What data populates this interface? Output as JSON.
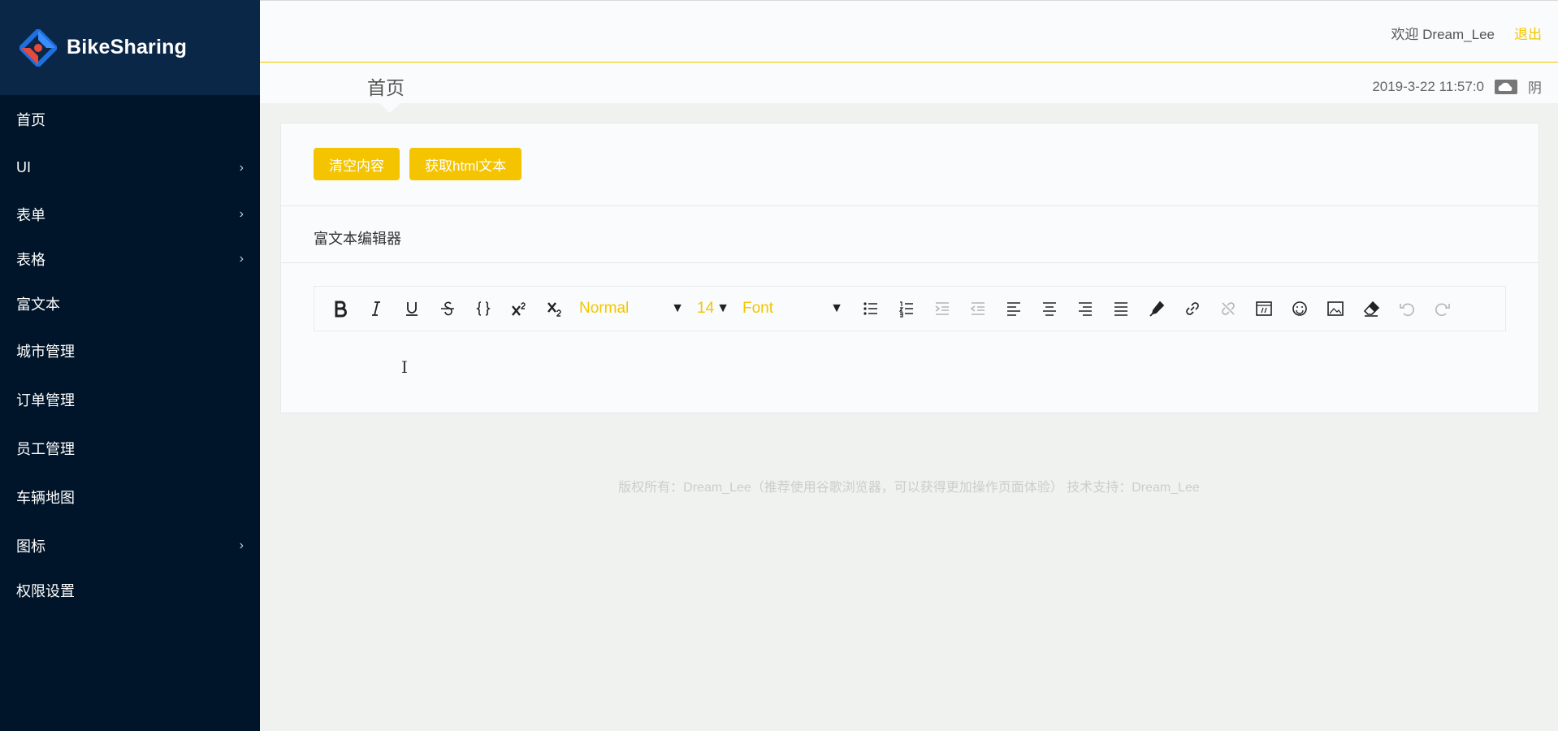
{
  "app": {
    "title": "BikeSharing"
  },
  "sidebar": {
    "items": [
      {
        "label": "首页",
        "has_children": false
      },
      {
        "label": "UI",
        "has_children": true
      },
      {
        "label": "表单",
        "has_children": true
      },
      {
        "label": "表格",
        "has_children": true
      },
      {
        "label": "富文本",
        "has_children": false
      },
      {
        "label": "城市管理",
        "has_children": false
      },
      {
        "label": "订单管理",
        "has_children": false
      },
      {
        "label": "员工管理",
        "has_children": false
      },
      {
        "label": "车辆地图",
        "has_children": false
      },
      {
        "label": "图标",
        "has_children": true
      },
      {
        "label": "权限设置",
        "has_children": false
      }
    ]
  },
  "header": {
    "welcome": "欢迎 Dream_Lee",
    "logout": "退出",
    "breadcrumb": "首页",
    "datetime": "2019-3-22 11:57:0",
    "weather": "阴",
    "weather_icon": "cloud-icon"
  },
  "actions": {
    "clear_label": "清空内容",
    "get_html_label": "获取html文本"
  },
  "editor": {
    "title": "富文本编辑器",
    "header_select": "Normal",
    "size_select": "14",
    "font_select": "Font",
    "toolbar_icons": [
      "bold-icon",
      "italic-icon",
      "underline-icon",
      "strikethrough-icon",
      "code-icon",
      "superscript-icon",
      "subscript-icon",
      "bullet-list-icon",
      "ordered-list-icon",
      "indent-icon",
      "outdent-icon",
      "align-left-icon",
      "align-center-icon",
      "align-right-icon",
      "align-justify-icon",
      "color-picker-icon",
      "link-icon",
      "unlink-icon",
      "embed-icon",
      "emoji-icon",
      "image-icon",
      "eraser-icon",
      "undo-icon",
      "redo-icon"
    ],
    "cursor_glyph": "I"
  },
  "footer": {
    "text": "版权所有：Dream_Lee（推荐使用谷歌浏览器，可以获得更加操作页面体验） 技术支持：Dream_Lee"
  },
  "colors": {
    "sidebar_bg": "#001529",
    "accent": "#f5c400",
    "page_bg": "#f0f2f0"
  }
}
